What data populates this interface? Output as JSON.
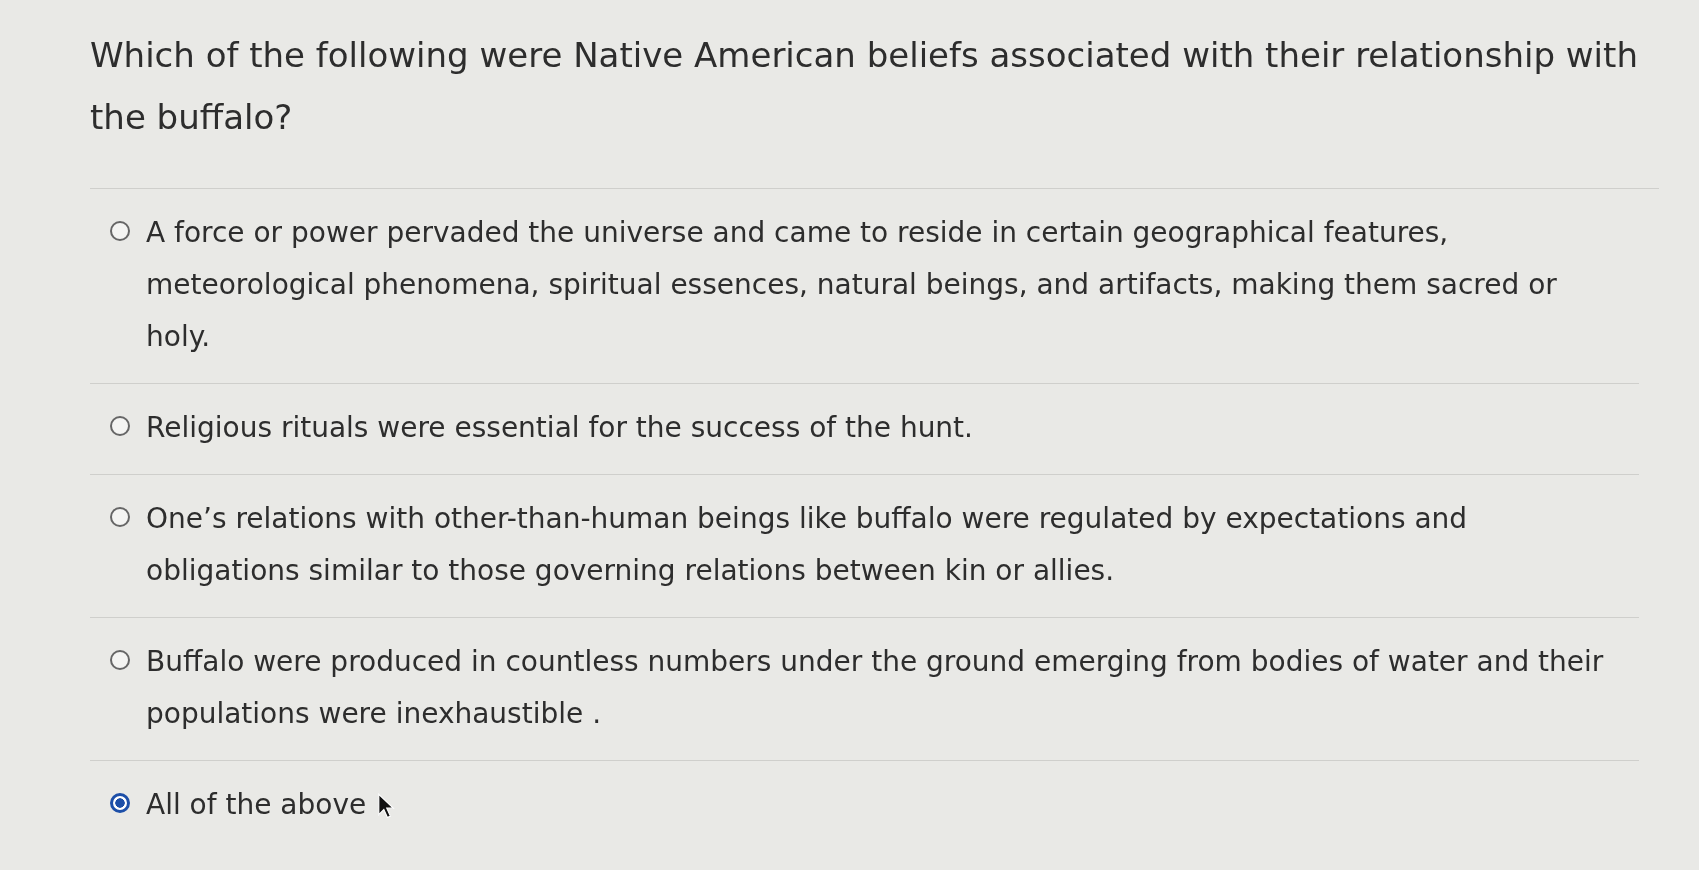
{
  "question": "Which of the following were Native American beliefs associated with their relationship with the buffalo?",
  "options": [
    {
      "label": "A force or power pervaded the universe and came to reside in certain geographical features, meteorological phenomena, spiritual essences, natural beings, and artifacts, making them sacred or holy.",
      "selected": false
    },
    {
      "label": "Religious rituals were essential for the success of the hunt.",
      "selected": false
    },
    {
      "label": "One’s relations with other-than-human beings like buffalo were regulated by expectations and obligations similar to those governing relations between kin or allies.",
      "selected": false
    },
    {
      "label": "Buffalo were produced in countless numbers under the ground emerging from bodies of water and their populations were inexhaustible .",
      "selected": false
    },
    {
      "label": "All of the above",
      "selected": true
    }
  ]
}
